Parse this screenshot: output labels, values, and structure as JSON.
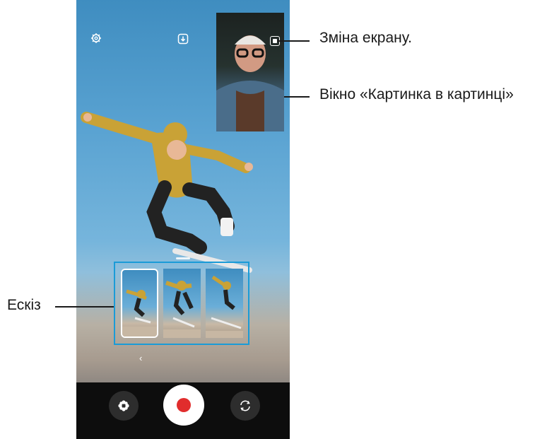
{
  "callouts": {
    "switch_screen": "Зміна екрану.",
    "pip_window": "Вікно «Картинка в картинці»",
    "thumbnail": "Ескіз"
  },
  "camera": {
    "settings_icon": "gear-icon",
    "save_icon": "download-icon",
    "switch_icon": "screen-switch-icon",
    "effects_icon": "flower-icon",
    "record_icon": "record-icon",
    "flip_icon": "flip-camera-icon",
    "back_icon": "chevron-left-icon"
  },
  "colors": {
    "highlight": "#1a9bd7",
    "record": "#e12d2d",
    "bar": "#0d0d0d"
  }
}
